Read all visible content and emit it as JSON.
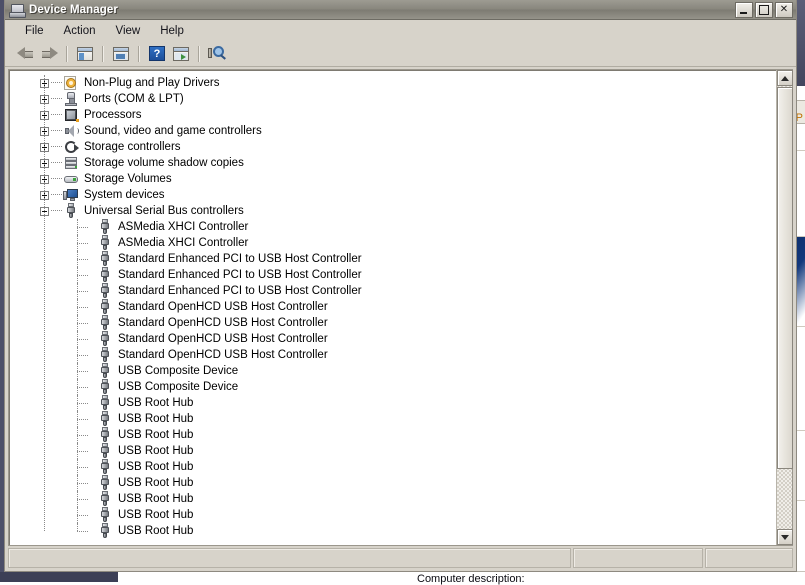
{
  "window": {
    "title": "Device Manager",
    "icon": "device-manager-icon",
    "controls": {
      "minimize": "_",
      "maximize": "□",
      "close": "✕"
    }
  },
  "menubar": {
    "items": [
      {
        "label": "File"
      },
      {
        "label": "Action"
      },
      {
        "label": "View"
      },
      {
        "label": "Help"
      }
    ]
  },
  "toolbar": {
    "buttons": [
      {
        "name": "back-button",
        "icon": "back-arrow-icon",
        "label": "Back"
      },
      {
        "name": "forward-button",
        "icon": "forward-arrow-icon",
        "label": "Forward"
      },
      {
        "name": "show-hide-console-tree-button",
        "icon": "console-tree-icon",
        "label": "Show/Hide Console Tree"
      },
      {
        "name": "properties-button",
        "icon": "properties-window-icon",
        "label": "Properties"
      },
      {
        "name": "help-button",
        "icon": "help-question-icon",
        "label": "Help"
      },
      {
        "name": "update-driver-button",
        "icon": "update-driver-icon",
        "label": "Update Driver Software"
      },
      {
        "name": "scan-hardware-changes-button",
        "icon": "scan-hardware-icon",
        "label": "Scan for hardware changes"
      }
    ]
  },
  "tree": {
    "nodes": [
      {
        "label": "Non-Plug and Play Drivers",
        "level": 1,
        "state": "collapsed",
        "icon": "gear-document-icon"
      },
      {
        "label": "Ports (COM & LPT)",
        "level": 1,
        "state": "collapsed",
        "icon": "port-icon"
      },
      {
        "label": "Processors",
        "level": 1,
        "state": "collapsed",
        "icon": "processor-icon"
      },
      {
        "label": "Sound, video and game controllers",
        "level": 1,
        "state": "collapsed",
        "icon": "speaker-icon"
      },
      {
        "label": "Storage controllers",
        "level": 1,
        "state": "collapsed",
        "icon": "storage-controller-icon"
      },
      {
        "label": "Storage volume shadow copies",
        "level": 1,
        "state": "collapsed",
        "icon": "disk-stack-icon"
      },
      {
        "label": "Storage Volumes",
        "level": 1,
        "state": "collapsed",
        "icon": "volume-icon"
      },
      {
        "label": "System devices",
        "level": 1,
        "state": "collapsed",
        "icon": "system-device-icon"
      },
      {
        "label": "Universal Serial Bus controllers",
        "level": 1,
        "state": "expanded",
        "icon": "usb-icon"
      },
      {
        "label": "ASMedia XHCI Controller",
        "level": 2,
        "state": "leaf",
        "icon": "usb-icon"
      },
      {
        "label": "ASMedia XHCI Controller",
        "level": 2,
        "state": "leaf",
        "icon": "usb-icon"
      },
      {
        "label": "Standard Enhanced PCI to USB Host Controller",
        "level": 2,
        "state": "leaf",
        "icon": "usb-icon"
      },
      {
        "label": "Standard Enhanced PCI to USB Host Controller",
        "level": 2,
        "state": "leaf",
        "icon": "usb-icon"
      },
      {
        "label": "Standard Enhanced PCI to USB Host Controller",
        "level": 2,
        "state": "leaf",
        "icon": "usb-icon"
      },
      {
        "label": "Standard OpenHCD USB Host Controller",
        "level": 2,
        "state": "leaf",
        "icon": "usb-icon"
      },
      {
        "label": "Standard OpenHCD USB Host Controller",
        "level": 2,
        "state": "leaf",
        "icon": "usb-icon"
      },
      {
        "label": "Standard OpenHCD USB Host Controller",
        "level": 2,
        "state": "leaf",
        "icon": "usb-icon"
      },
      {
        "label": "Standard OpenHCD USB Host Controller",
        "level": 2,
        "state": "leaf",
        "icon": "usb-icon"
      },
      {
        "label": "USB Composite Device",
        "level": 2,
        "state": "leaf",
        "icon": "usb-icon"
      },
      {
        "label": "USB Composite Device",
        "level": 2,
        "state": "leaf",
        "icon": "usb-icon"
      },
      {
        "label": "USB Root Hub",
        "level": 2,
        "state": "leaf",
        "icon": "usb-icon"
      },
      {
        "label": "USB Root Hub",
        "level": 2,
        "state": "leaf",
        "icon": "usb-icon"
      },
      {
        "label": "USB Root Hub",
        "level": 2,
        "state": "leaf",
        "icon": "usb-icon"
      },
      {
        "label": "USB Root Hub",
        "level": 2,
        "state": "leaf",
        "icon": "usb-icon"
      },
      {
        "label": "USB Root Hub",
        "level": 2,
        "state": "leaf",
        "icon": "usb-icon"
      },
      {
        "label": "USB Root Hub",
        "level": 2,
        "state": "leaf",
        "icon": "usb-icon"
      },
      {
        "label": "USB Root Hub",
        "level": 2,
        "state": "leaf",
        "icon": "usb-icon"
      },
      {
        "label": "USB Root Hub",
        "level": 2,
        "state": "leaf",
        "icon": "usb-icon"
      },
      {
        "label": "USB Root Hub",
        "level": 2,
        "state": "leaf",
        "icon": "usb-icon"
      }
    ]
  },
  "scrollbar": {
    "up_arrow": "▲",
    "down_arrow": "▼"
  },
  "statusbar": {
    "pane1": "",
    "pane2": "",
    "pane3": ""
  },
  "background": {
    "clipped_label": "Computer description:",
    "side_letter": "P"
  },
  "colors": {
    "window_face": "#d7d3ca",
    "titlebar_inactive": "#8b8980",
    "client_bg": "#ffffff",
    "text": "#000000",
    "desktop_edge": "#4c4f68",
    "accent_blue": "#1d4e99"
  }
}
